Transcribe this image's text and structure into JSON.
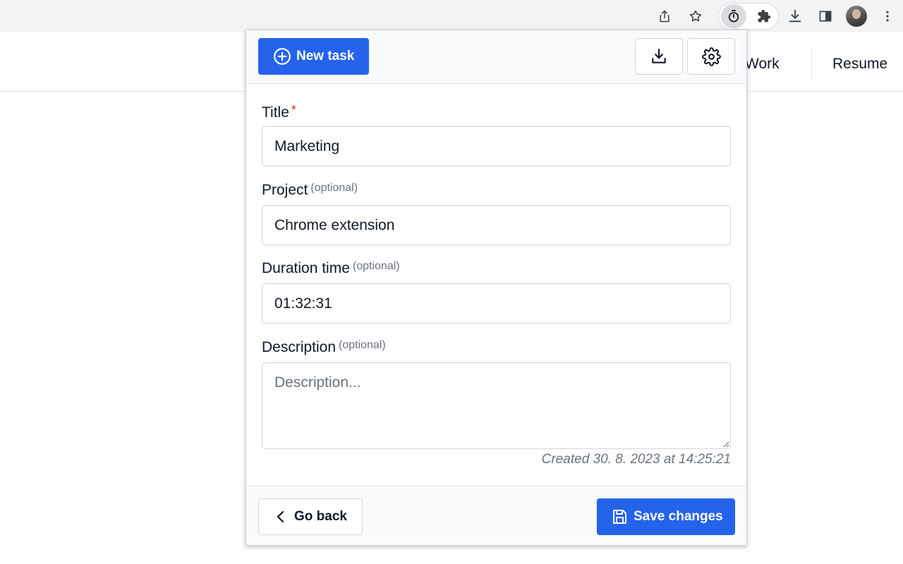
{
  "browser": {
    "toolbar_icons": [
      "share-icon",
      "bookmark-star-icon",
      "stopwatch-extension-icon",
      "puzzle-extensions-icon",
      "download-icon",
      "side-panel-icon",
      "profile-avatar",
      "more-vert-icon"
    ]
  },
  "page": {
    "nav": {
      "work_label": "Work",
      "resume_label": "Resume"
    }
  },
  "popup": {
    "header": {
      "new_task_label": "New task",
      "export_icon": "download-icon",
      "settings_icon": "gear-icon"
    },
    "form": {
      "title": {
        "label": "Title",
        "required_mark": "*",
        "value": "Marketing"
      },
      "project": {
        "label": "Project",
        "optional_note": "(optional)",
        "value": "Chrome extension"
      },
      "duration": {
        "label": "Duration time",
        "optional_note": "(optional)",
        "value": "01:32:31"
      },
      "description": {
        "label": "Description",
        "optional_note": "(optional)",
        "value": "",
        "placeholder": "Description..."
      },
      "created_text": "Created 30. 8. 2023 at 14:25:21"
    },
    "footer": {
      "back_label": "Go back",
      "save_label": "Save changes"
    }
  },
  "colors": {
    "primary": "#2563eb",
    "required": "#dc2626",
    "muted": "#6b7280",
    "border": "#d1d5db"
  }
}
